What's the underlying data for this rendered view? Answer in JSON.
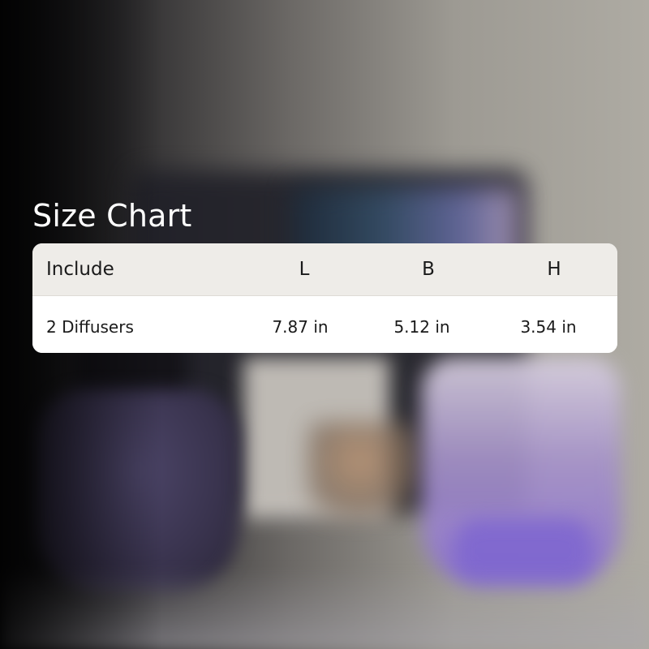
{
  "title": "Size Chart",
  "table": {
    "headers": [
      "Include",
      "L",
      "B",
      "H"
    ],
    "rows": [
      [
        "2 Diffusers",
        "7.87 in",
        "5.12 in",
        "3.54 in"
      ]
    ]
  },
  "colors": {
    "title_text": "#ffffff",
    "header_background": "#eeece8",
    "row_background": "#ffffff",
    "cell_text": "#1a1a1a"
  }
}
